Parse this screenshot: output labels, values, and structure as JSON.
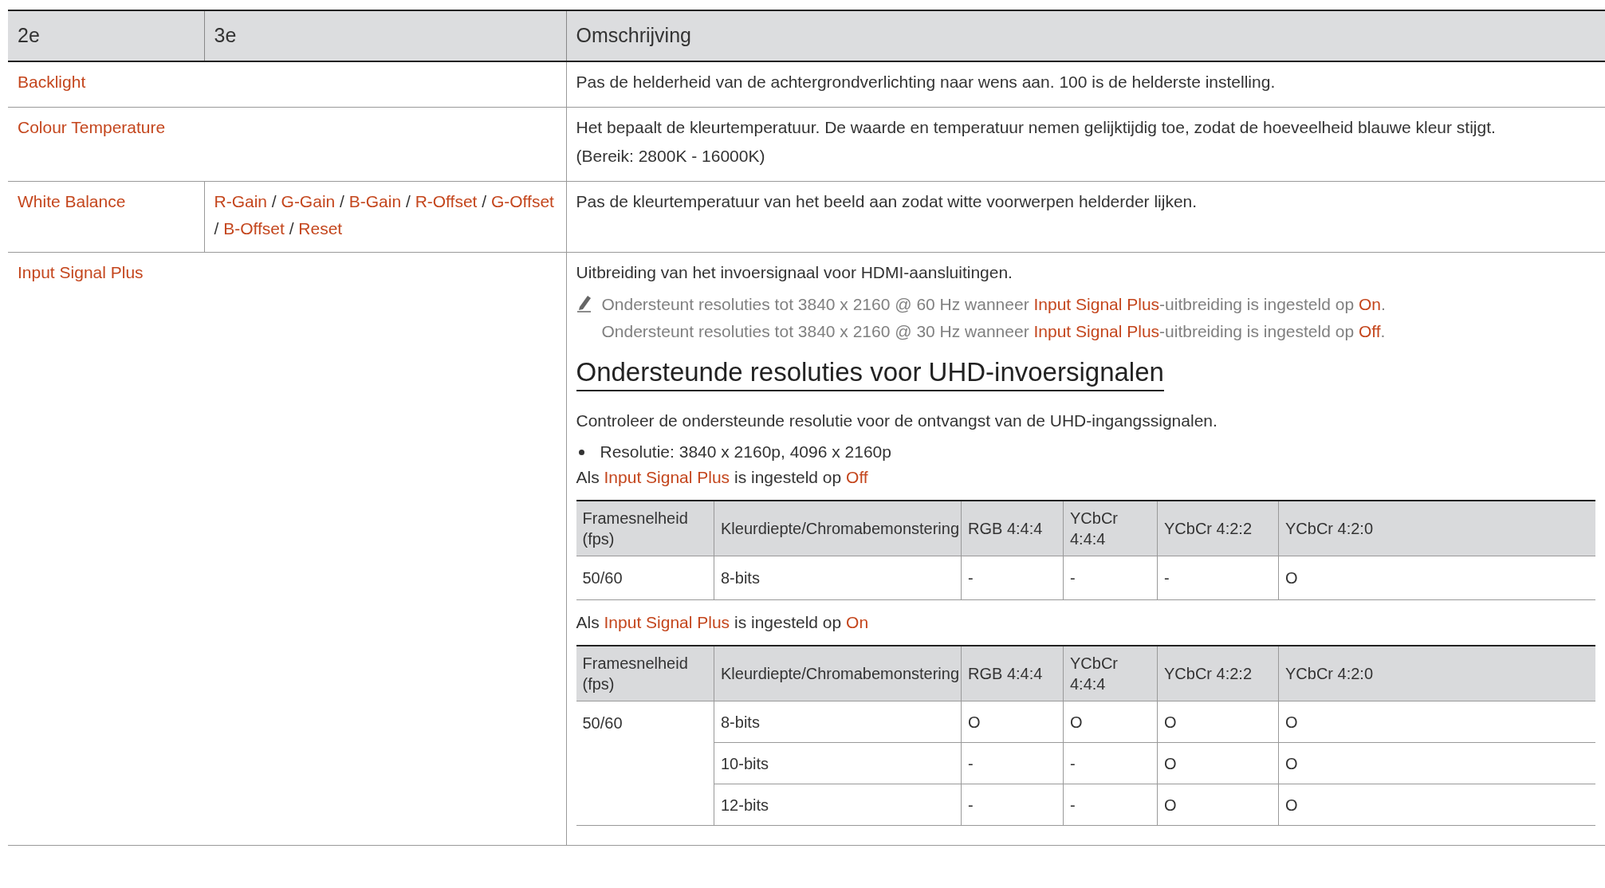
{
  "table": {
    "columns": [
      "2e",
      "3e",
      "Omschrijving"
    ],
    "rows": [
      {
        "label": "Backlight",
        "description": [
          {
            "kind": "text",
            "segments": [
              {
                "text": "Pas de helderheid van de achtergrondverlichting naar wens aan. 100 is de helderste instelling.",
                "highlight": false
              }
            ]
          }
        ]
      },
      {
        "label": "Colour Temperature",
        "description": [
          {
            "kind": "text",
            "segments": [
              {
                "text": "Het bepaalt de kleurtemperatuur. De waarde en temperatuur nemen gelijktijdig toe, zodat de hoeveelheid blauwe kleur stijgt.",
                "highlight": false
              }
            ]
          },
          {
            "kind": "text",
            "segments": [
              {
                "text": "(Bereik: 2800K - 16000K)",
                "highlight": false
              }
            ]
          }
        ]
      },
      {
        "label": "White Balance",
        "sub": [
          {
            "text": "R-Gain",
            "highlight": true
          },
          {
            "text": " / ",
            "highlight": false
          },
          {
            "text": "G-Gain",
            "highlight": true
          },
          {
            "text": " / ",
            "highlight": false
          },
          {
            "text": "B-Gain",
            "highlight": true
          },
          {
            "text": " / ",
            "highlight": false
          },
          {
            "text": "R-Offset",
            "highlight": true
          },
          {
            "text": " / ",
            "highlight": false
          },
          {
            "text": "G-Offset",
            "highlight": true
          },
          {
            "text": " / ",
            "highlight": false
          },
          {
            "text": "B-Offset",
            "highlight": true
          },
          {
            "text": " / ",
            "highlight": false
          },
          {
            "text": "Reset",
            "highlight": true
          }
        ],
        "description": [
          {
            "kind": "text",
            "segments": [
              {
                "text": "Pas de kleurtemperatuur van het beeld aan zodat witte voorwerpen helderder lijken.",
                "highlight": false
              }
            ]
          }
        ]
      },
      {
        "label": "Input Signal Plus",
        "description": [
          {
            "kind": "text",
            "segments": [
              {
                "text": "Uitbreiding van het invoersignaal voor HDMI-aansluitingen.",
                "highlight": false
              }
            ]
          },
          {
            "kind": "note",
            "lines": [
              [
                {
                  "text": "Ondersteunt resoluties tot 3840 x 2160 @ 60 Hz wanneer ",
                  "highlight": false
                },
                {
                  "text": "Input Signal Plus",
                  "highlight": true
                },
                {
                  "text": "-uitbreiding is ingesteld op ",
                  "highlight": false
                },
                {
                  "text": "On",
                  "highlight": true
                },
                {
                  "text": ".",
                  "highlight": false
                }
              ],
              [
                {
                  "text": "Ondersteunt resoluties tot 3840 x 2160 @ 30 Hz wanneer ",
                  "highlight": false
                },
                {
                  "text": "Input Signal Plus",
                  "highlight": true
                },
                {
                  "text": "-uitbreiding is ingesteld op ",
                  "highlight": false
                },
                {
                  "text": "Off",
                  "highlight": true
                },
                {
                  "text": ".",
                  "highlight": false
                }
              ]
            ]
          },
          {
            "kind": "heading",
            "segments": [
              {
                "text": "Ondersteunde resoluties voor UHD-invoersignalen",
                "highlight": false
              }
            ]
          },
          {
            "kind": "text",
            "segments": [
              {
                "text": "Controleer de ondersteunde resolutie voor de ontvangst van de UHD-ingangssignalen.",
                "highlight": false
              }
            ]
          },
          {
            "kind": "bullet",
            "segments": [
              {
                "text": "Resolutie: 3840 x 2160p, 4096 x 2160p",
                "highlight": false
              }
            ]
          },
          {
            "kind": "caption",
            "segments": [
              {
                "text": "Als ",
                "highlight": false
              },
              {
                "text": "Input Signal Plus",
                "highlight": true
              },
              {
                "text": " is ingesteld op ",
                "highlight": false
              },
              {
                "text": "Off",
                "highlight": true
              }
            ]
          },
          {
            "kind": "table",
            "columns": [
              "Framesnelheid (fps)",
              "Kleurdiepte/Chromabemonstering",
              "RGB 4:4:4",
              "YCbCr 4:4:4",
              "YCbCr 4:2:2",
              "YCbCr 4:2:0"
            ],
            "groups": [
              {
                "rate": "50/60",
                "rows": [
                  [
                    "8-bits",
                    "-",
                    "-",
                    "-",
                    "O"
                  ]
                ]
              }
            ]
          },
          {
            "kind": "caption",
            "segments": [
              {
                "text": "Als ",
                "highlight": false
              },
              {
                "text": "Input Signal Plus",
                "highlight": true
              },
              {
                "text": " is ingesteld op ",
                "highlight": false
              },
              {
                "text": "On",
                "highlight": true
              }
            ]
          },
          {
            "kind": "table",
            "columns": [
              "Framesnelheid (fps)",
              "Kleurdiepte/Chromabemonstering",
              "RGB 4:4:4",
              "YCbCr 4:4:4",
              "YCbCr 4:2:2",
              "YCbCr 4:2:0"
            ],
            "groups": [
              {
                "rate": "50/60",
                "rows": [
                  [
                    "8-bits",
                    "O",
                    "O",
                    "O",
                    "O"
                  ],
                  [
                    "10-bits",
                    "-",
                    "-",
                    "O",
                    "O"
                  ],
                  [
                    "12-bits",
                    "-",
                    "-",
                    "O",
                    "O"
                  ]
                ]
              }
            ]
          }
        ]
      }
    ]
  }
}
